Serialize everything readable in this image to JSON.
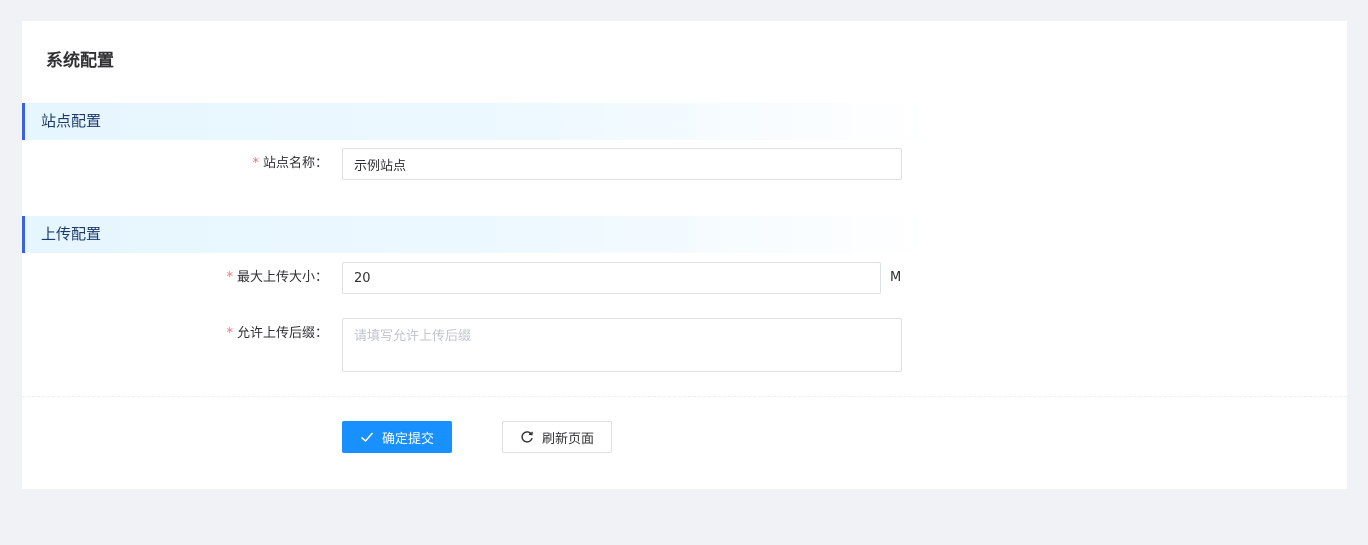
{
  "page": {
    "title": "系统配置"
  },
  "sections": {
    "site": {
      "title": "站点配置",
      "site_name": {
        "label": "站点名称：",
        "value": "示例站点"
      }
    },
    "upload": {
      "title": "上传配置",
      "max_size": {
        "label": "最大上传大小：",
        "value": "20",
        "unit": "M"
      },
      "allowed_ext": {
        "label": "允许上传后缀：",
        "value": "",
        "placeholder": "请填写允许上传后缀"
      }
    }
  },
  "actions": {
    "submit_label": "确定提交",
    "refresh_label": "刷新页面"
  },
  "required_mark": "*",
  "icons": {
    "submit": "check-icon",
    "refresh": "refresh-icon"
  },
  "colors": {
    "primary": "#1890ff",
    "section_accent": "#3a61e0",
    "required": "#f56c6c"
  }
}
